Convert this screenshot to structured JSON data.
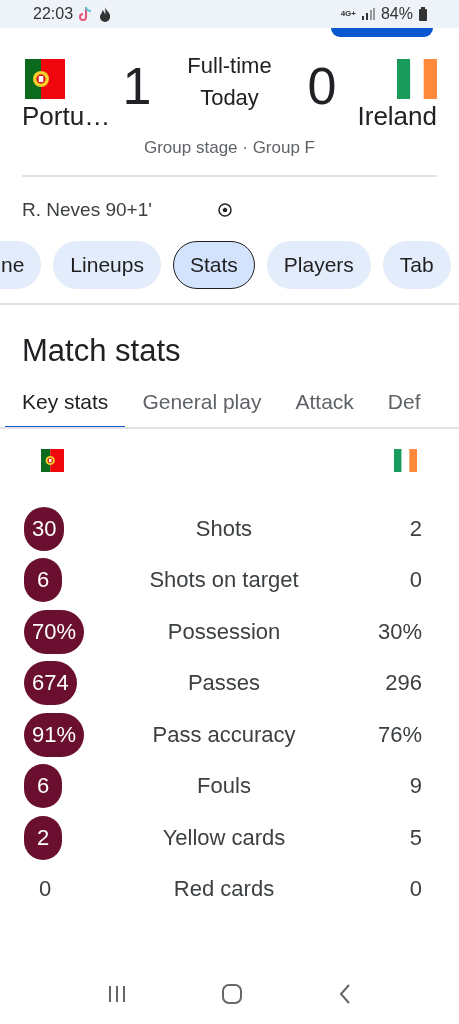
{
  "status_bar": {
    "time": "22:03",
    "network": "4G+",
    "battery": "84%"
  },
  "match": {
    "home": {
      "name": "Portu…",
      "score": "1"
    },
    "away": {
      "name": "Ireland",
      "score": "0"
    },
    "status": "Full-time",
    "date": "Today",
    "stage": "Group stage · Group F"
  },
  "goals": [
    {
      "text": "R. Neves 90+1'"
    }
  ],
  "chips": [
    {
      "label": "ne",
      "selected": false
    },
    {
      "label": "Lineups",
      "selected": false
    },
    {
      "label": "Stats",
      "selected": true
    },
    {
      "label": "Players",
      "selected": false
    },
    {
      "label": "Tab",
      "selected": false
    }
  ],
  "section_title": "Match stats",
  "tabs": [
    {
      "label": "Key stats",
      "selected": true
    },
    {
      "label": "General play",
      "selected": false
    },
    {
      "label": "Attack",
      "selected": false
    },
    {
      "label": "Def",
      "selected": false
    }
  ],
  "stats": [
    {
      "label": "Shots",
      "home": "30",
      "away": "2",
      "home_highlighted": true
    },
    {
      "label": "Shots on target",
      "home": "6",
      "away": "0",
      "home_highlighted": true
    },
    {
      "label": "Possession",
      "home": "70%",
      "away": "30%",
      "home_highlighted": true
    },
    {
      "label": "Passes",
      "home": "674",
      "away": "296",
      "home_highlighted": true
    },
    {
      "label": "Pass accuracy",
      "home": "91%",
      "away": "76%",
      "home_highlighted": true
    },
    {
      "label": "Fouls",
      "home": "6",
      "away": "9",
      "home_highlighted": true
    },
    {
      "label": "Yellow cards",
      "home": "2",
      "away": "5",
      "home_highlighted": true
    },
    {
      "label": "Red cards",
      "home": "0",
      "away": "0",
      "home_highlighted": false
    }
  ]
}
